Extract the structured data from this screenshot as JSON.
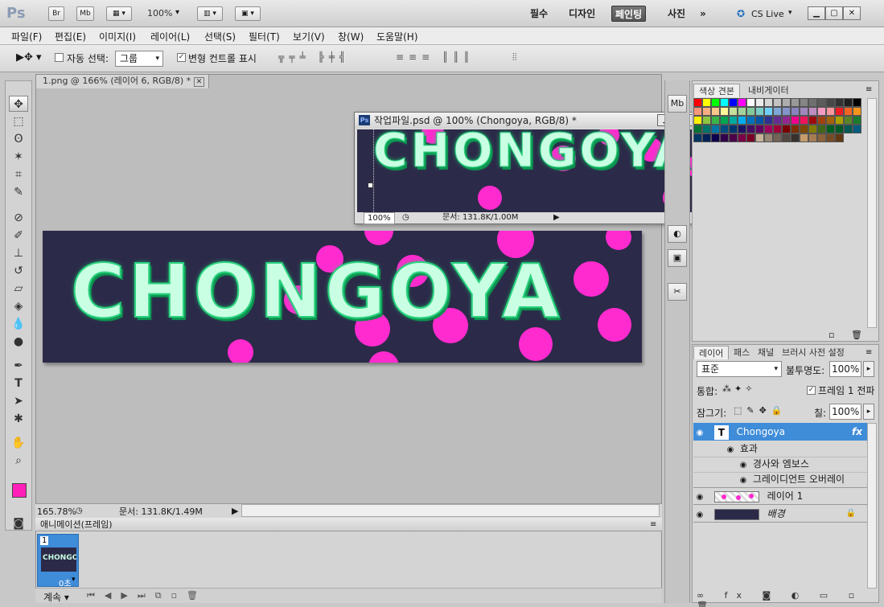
{
  "app": {
    "logo": "Ps",
    "br_label": "Br",
    "mb_label": "Mb",
    "zoom": "100%"
  },
  "workspaces": [
    {
      "label": "필수"
    },
    {
      "label": "디자인"
    },
    {
      "label": "페인팅"
    },
    {
      "label": "사진"
    }
  ],
  "more_label": "»",
  "cslive": "CS Live",
  "menus": [
    "파일(F)",
    "편집(E)",
    "이미지(I)",
    "레이어(L)",
    "선택(S)",
    "필터(T)",
    "보기(V)",
    "창(W)",
    "도움말(H)"
  ],
  "options": {
    "auto_select_label": "자동 선택:",
    "auto_select_value": "그룹",
    "transform_label": "변형 컨트롤 표시"
  },
  "doc": {
    "tab_title": "1.png @ 166% (레이어 6, RGB/8) *",
    "zoom": "165.78%",
    "doc_size": "문서: 131.8K/1.49M"
  },
  "banner": {
    "text": "CHONGOYA"
  },
  "float_win": {
    "title": "작업파일.psd @ 100% (Chongoya, RGB/8) *",
    "zoom": "100%",
    "doc_size": "문서: 131.8K/1.00M"
  },
  "swatch_panel": {
    "tab1": "색상 견본",
    "tab2": "내비게이터"
  },
  "swatch_colors": [
    "#ff0000",
    "#ffff00",
    "#00ff00",
    "#00ffff",
    "#0000ff",
    "#ff00ff",
    "#ffffff",
    "#ebebeb",
    "#d6d6d6",
    "#c2c2c2",
    "#adadad",
    "#999999",
    "#858585",
    "#707070",
    "#5c5c5c",
    "#474747",
    "#333333",
    "#1f1f1f",
    "#000000",
    "#f7977a",
    "#f9ad81",
    "#fdc68a",
    "#fff79a",
    "#c4df9b",
    "#a2d39c",
    "#82ca9d",
    "#7bcdc8",
    "#6ecff6",
    "#7ea7d8",
    "#8493ca",
    "#8882be",
    "#a187be",
    "#bc8dbf",
    "#f49ac2",
    "#f6989d",
    "#ed1c24",
    "#f26522",
    "#f7941d",
    "#fff200",
    "#8dc63f",
    "#39b54a",
    "#00a651",
    "#00a99d",
    "#00aeef",
    "#0072bc",
    "#0054a6",
    "#2e3192",
    "#662d91",
    "#92278f",
    "#ec008c",
    "#ed145b",
    "#9e0b0f",
    "#a0410d",
    "#a3620a",
    "#aba000",
    "#598527",
    "#1a7b30",
    "#007236",
    "#00746b",
    "#0076a3",
    "#004b80",
    "#003471",
    "#1b1464",
    "#440e62",
    "#630460",
    "#9e005d",
    "#9e0039",
    "#790000",
    "#7b2e00",
    "#7d4900",
    "#827b00",
    "#406618",
    "#005e20",
    "#005826",
    "#005952",
    "#005b7f",
    "#003663",
    "#002157",
    "#0d004c",
    "#32004b",
    "#4b0049",
    "#7b0046",
    "#7a0026",
    "#c7b299",
    "#998675",
    "#736357",
    "#534741",
    "#37302d",
    "#c69c6d",
    "#a67c52",
    "#8c6239",
    "#754c24",
    "#603913"
  ],
  "layers_panel": {
    "tab1": "레이어",
    "tab2": "패스",
    "tab3": "채널",
    "tab4": "브러시 사전 설정",
    "blend": "표준",
    "opacity_label": "불투명도:",
    "opacity": "100%",
    "unify_label": "통합:",
    "propagate_label": "프레임 1 전파",
    "lock_label": "잠그기:",
    "fill_label": "칠:",
    "fill": "100%"
  },
  "layers": [
    {
      "name": "Chongoya",
      "type": "text",
      "selected": true
    },
    {
      "name": "효과",
      "type": "effects"
    },
    {
      "name": "경사와 엠보스",
      "type": "effect"
    },
    {
      "name": "그레이디언트 오버레이",
      "type": "effect"
    },
    {
      "name": "레이어 1",
      "type": "pixel"
    },
    {
      "name": "배경",
      "type": "background"
    }
  ],
  "animation": {
    "title": "애니메이션(프레임)",
    "frame_number": "1",
    "frame_delay": "0초",
    "loop": "계속"
  }
}
